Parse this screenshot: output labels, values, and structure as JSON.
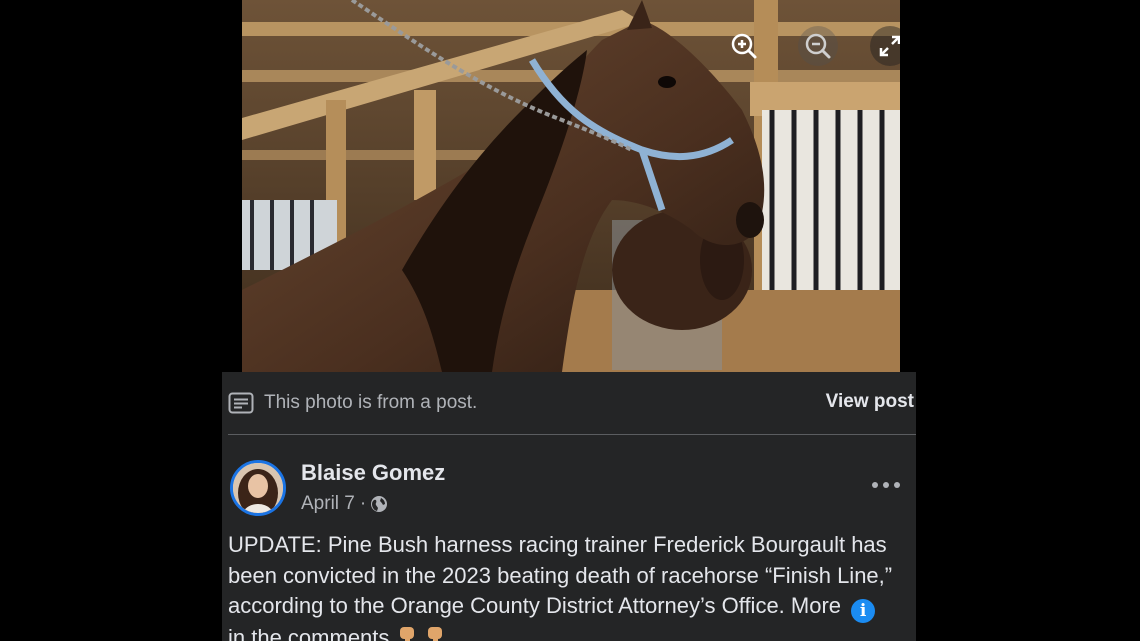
{
  "notice": {
    "text": "This photo is from a post.",
    "view_post_label": "View post"
  },
  "post": {
    "author": "Blaise Gomez",
    "date": "April 7",
    "separator": "·",
    "text_main": "UPDATE: Pine Bush harness racing trainer Frederick Bourgault has been convicted in the 2023 beating death of racehorse “Finish Line,” according to the Orange County District Attorney’s Office. More",
    "text_tail": "in the comments",
    "info_glyph": "i",
    "audience": "globe-icon",
    "emojis": [
      "information-emoji",
      "pointing-down-emoji",
      "pointing-down-emoji"
    ]
  },
  "photo_controls": [
    "zoom-in-icon",
    "zoom-out-icon",
    "fullscreen-icon"
  ],
  "colors": {
    "panel_bg": "#242526",
    "text_primary": "#e4e6eb",
    "text_secondary": "#b0b3b8",
    "accent": "#1b74e4"
  }
}
